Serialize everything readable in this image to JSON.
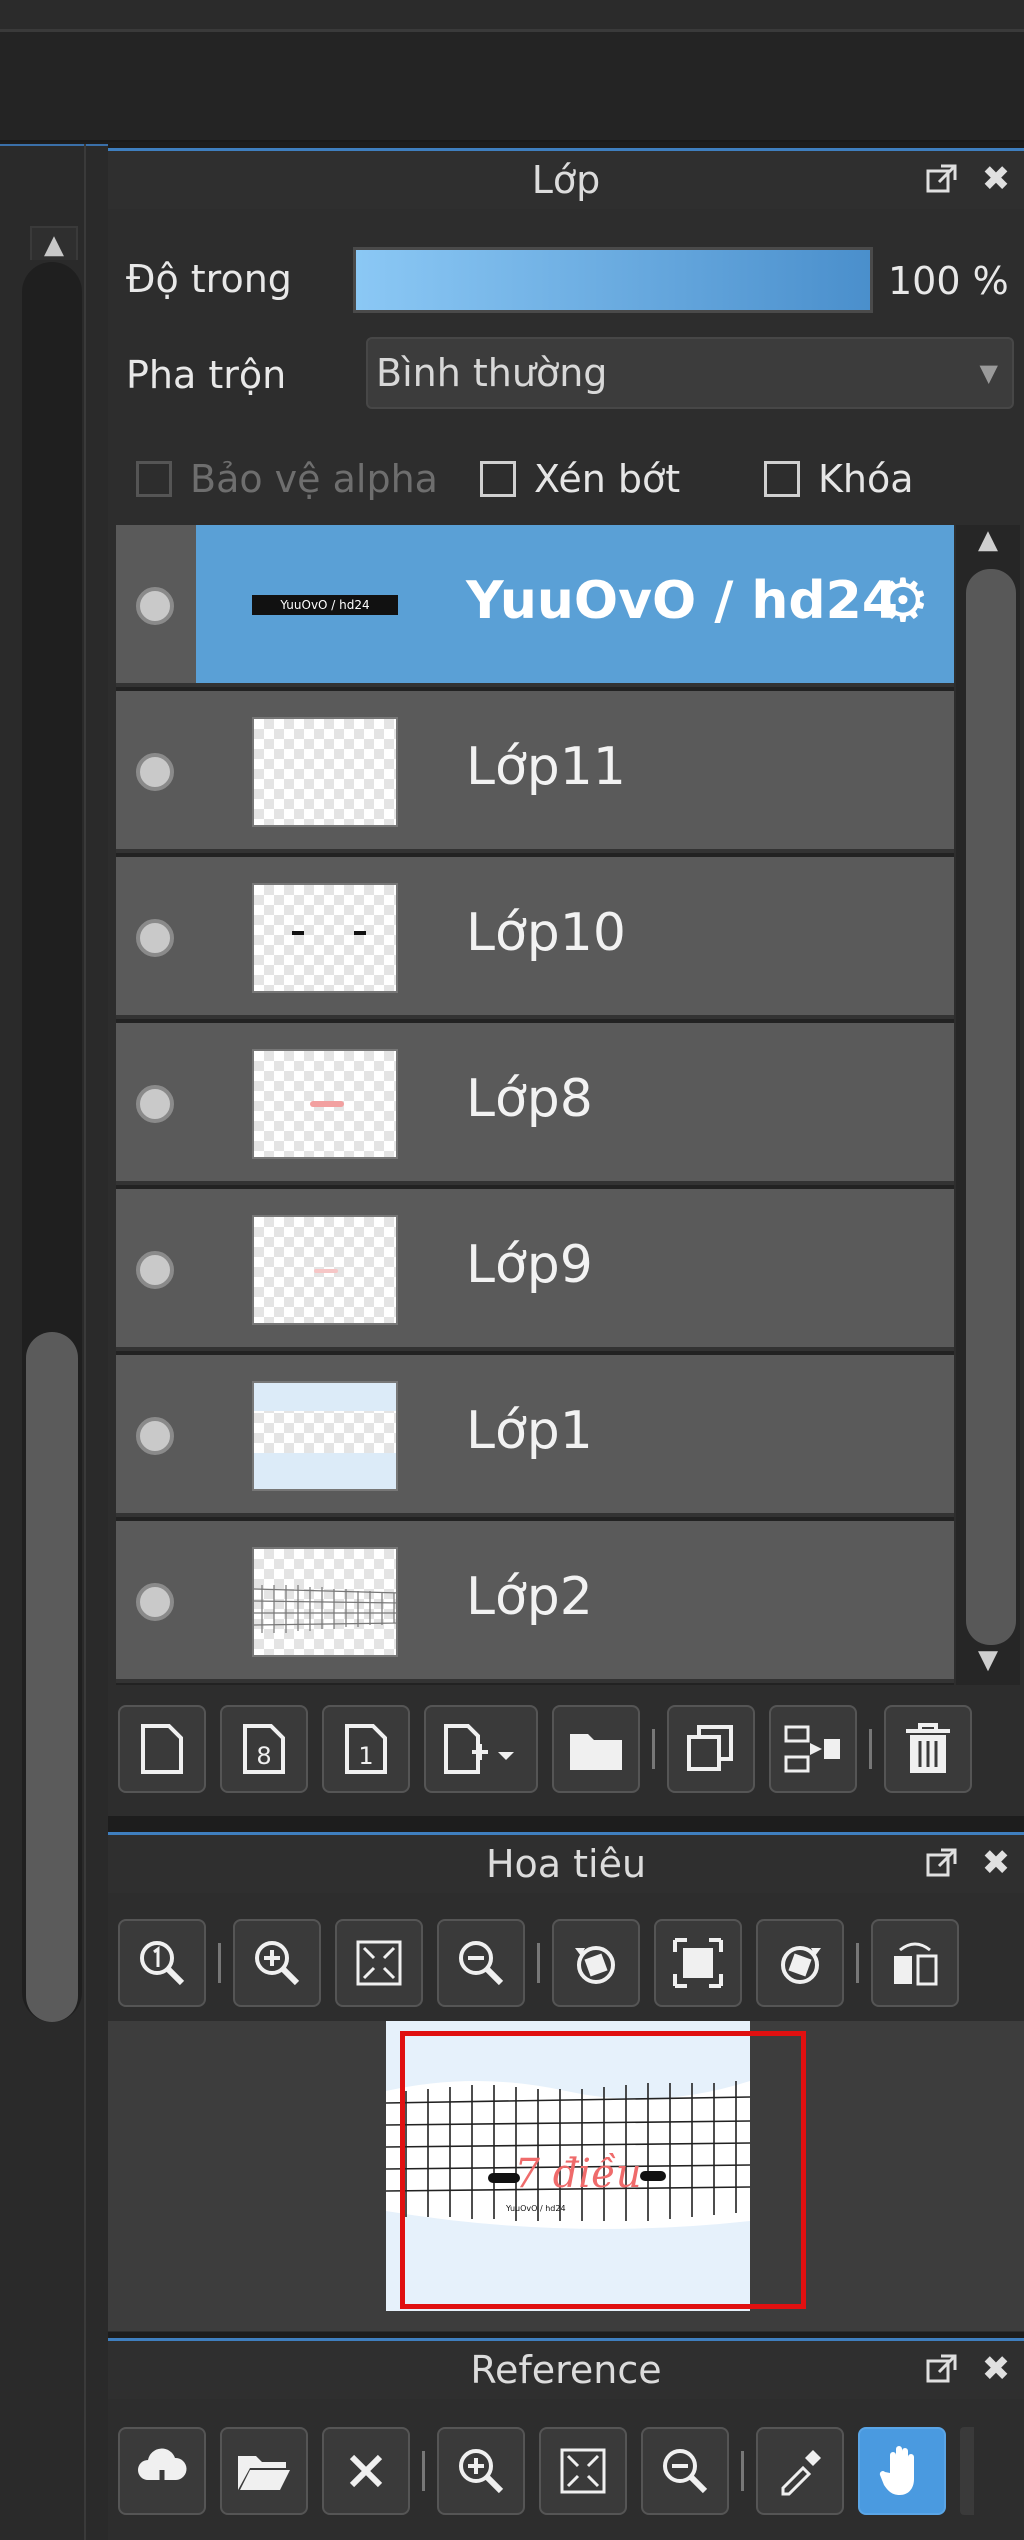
{
  "layer_panel": {
    "title": "Lớp",
    "opacity_label": "Độ trong",
    "opacity_value": "100 %",
    "opacity": 1.0,
    "blend_label": "Pha trộn",
    "blend_value": "Bình thường",
    "protect_alpha_label": "Bảo vệ alpha",
    "clip_label": "Xén bớt",
    "lock_label": "Khóa",
    "layers": [
      {
        "name": "YuuOvO / hd24",
        "selected": true,
        "thumb_text": "YuuOvO / hd24"
      },
      {
        "name": "Lớp11"
      },
      {
        "name": "Lớp10",
        "thumb_text": "-  -"
      },
      {
        "name": "Lớp8"
      },
      {
        "name": "Lớp9"
      },
      {
        "name": "Lớp1"
      },
      {
        "name": "Lớp2"
      }
    ],
    "buttons": {
      "new_layer": "new-page-icon",
      "new_8bit": "8",
      "new_1bit": "1",
      "add_more": "add-layer-dropdown-icon",
      "folder": "folder-icon",
      "duplicate": "duplicate-icon",
      "merge": "merge-down-icon",
      "delete": "trash-icon"
    }
  },
  "navigator_panel": {
    "title": "Hoa tiêu",
    "preview_text": "7 điều",
    "preview_caption": "YuuOvO / hd24"
  },
  "reference_panel": {
    "title": "Reference"
  },
  "colors": {
    "accent": "#5aa0d6",
    "panel_bg": "#2d2d2d",
    "nav_frame": "#e01010"
  }
}
